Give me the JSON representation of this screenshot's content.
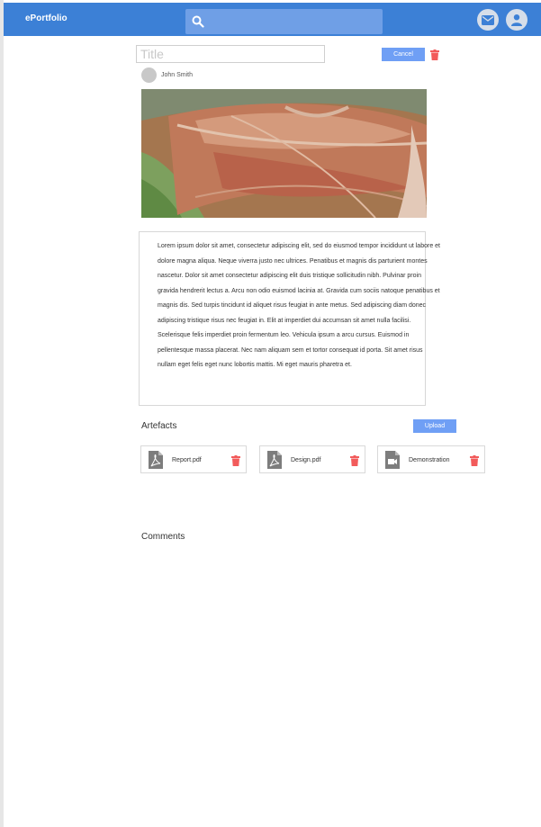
{
  "navbar": {
    "brand": "ePortfolio",
    "search_placeholder": "",
    "icons": [
      "search-icon",
      "mail-icon",
      "user-icon"
    ]
  },
  "post": {
    "title_placeholder": "Title",
    "title_value": "",
    "cancel_label": "Cancel",
    "author": "John Smith",
    "image_alt": "Aerial view of a cleared construction site with red soil",
    "body": "Lorem ipsum dolor sit amet, consectetur adipiscing elit, sed do eiusmod tempor incididunt ut labore et dolore magna aliqua. Neque viverra justo nec ultrices. Penatibus et magnis dis parturient montes nascetur. Dolor sit amet consectetur adipiscing elit duis tristique sollicitudin nibh. Pulvinar proin gravida hendrerit lectus a. Arcu non odio euismod lacinia at. Gravida cum sociis natoque penatibus et magnis dis. Sed turpis tincidunt id aliquet risus feugiat in ante metus. Sed adipiscing diam donec adipiscing tristique risus nec feugiat in. Elit at imperdiet dui accumsan sit amet nulla facilisi. Scelerisque felis imperdiet proin fermentum leo. Vehicula ipsum a arcu cursus. Euismod in pellentesque massa placerat. Nec nam aliquam sem et tortor consequat id porta. Sit amet risus nullam eget felis eget nunc lobortis mattis. Mi eget mauris pharetra et."
  },
  "artefacts": {
    "heading": "Artefacts",
    "upload_label": "Upload",
    "items": [
      {
        "name": "Report.pdf",
        "icon": "pdf-file-icon"
      },
      {
        "name": "Design.pdf",
        "icon": "pdf-file-icon"
      },
      {
        "name": "Demonstration",
        "icon": "video-file-icon"
      }
    ]
  },
  "comments": {
    "heading": "Comments"
  },
  "colors": {
    "navbar": "#3c80d6",
    "search": "#6f9fe6",
    "button": "#6f9ff5",
    "delete": "#f25b5b"
  }
}
